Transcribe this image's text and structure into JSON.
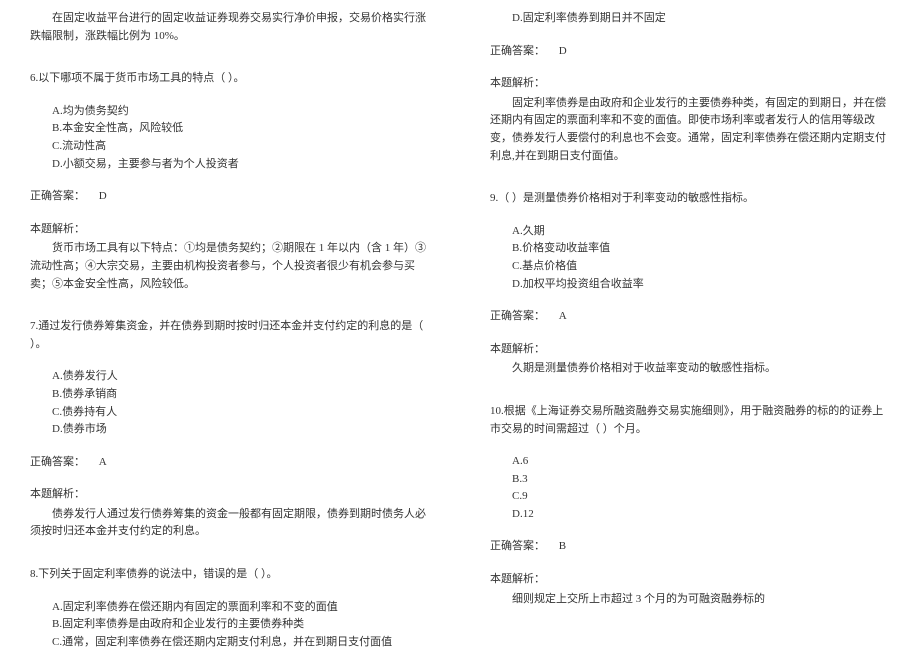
{
  "left_column": {
    "intro": "在固定收益平台进行的固定收益证券现券交易实行净价申报，交易价格实行涨跌幅限制，涨跌幅比例为 10%。",
    "q6": {
      "stem": "6.以下哪项不属于货币市场工具的特点（  ）。",
      "optA": "A.均为债务契约",
      "optB": "B.本金安全性高，风险较低",
      "optC": "C.流动性高",
      "optD": "D.小额交易，主要参与者为个人投资者",
      "answerLabel": "正确答案：",
      "answerValue": "D",
      "explLabel": "本题解析：",
      "explText": "货币市场工具有以下特点：①均是债务契约；②期限在 1 年以内（含 1 年）③流动性高；④大宗交易，主要由机构投资者参与，个人投资者很少有机会参与买卖；⑤本金安全性高，风险较低。"
    },
    "q7": {
      "stem": "7.通过发行债券筹集资金，并在债券到期时按时归还本金并支付约定的利息的是（  ）。",
      "optA": "A.债券发行人",
      "optB": "B.债券承销商",
      "optC": "C.债券持有人",
      "optD": "D.债券市场",
      "answerLabel": "正确答案：",
      "answerValue": "A",
      "explLabel": "本题解析：",
      "explText": "债券发行人通过发行债券筹集的资金一般都有固定期限，债券到期时债务人必须按时归还本金并支付约定的利息。"
    },
    "q8": {
      "stem": "8.下列关于固定利率债券的说法中，错误的是（  ）。",
      "optA": "A.固定利率债券在偿还期内有固定的票面利率和不变的面值",
      "optB": "B.固定利率债券是由政府和企业发行的主要债券种类",
      "optC": "C.通常，固定利率债券在偿还期内定期支付利息，并在到期日支付面值"
    }
  },
  "right_column": {
    "q8_cont": {
      "optD": "D.固定利率债券到期日并不固定",
      "answerLabel": "正确答案：",
      "answerValue": "D",
      "explLabel": "本题解析：",
      "explText": "固定利率债券是由政府和企业发行的主要债券种类，有固定的到期日，并在偿还期内有固定的票面利率和不变的面值。即使市场利率或者发行人的信用等级改变，债券发行人要偿付的利息也不会变。通常，固定利率债券在偿还期内定期支付利息,并在到期日支付面值。"
    },
    "q9": {
      "stem": "9.（  ）是测量债券价格相对于利率变动的敏感性指标。",
      "optA": "A.久期",
      "optB": "B.价格变动收益率值",
      "optC": "C.基点价格值",
      "optD": "D.加权平均投资组合收益率",
      "answerLabel": "正确答案：",
      "answerValue": "A",
      "explLabel": "本题解析：",
      "explText": "久期是测量债券价格相对于收益率变动的敏感性指标。"
    },
    "q10": {
      "stem": "10.根据《上海证券交易所融资融券交易实施细则》，用于融资融券的标的的证券上市交易的时间需超过（  ）个月。",
      "optA": "A.6",
      "optB": "B.3",
      "optC": "C.9",
      "optD": "D.12",
      "answerLabel": "正确答案：",
      "answerValue": "B",
      "explLabel": "本题解析：",
      "explText": "细则规定上交所上市超过 3 个月的为可融资融券标的"
    }
  }
}
